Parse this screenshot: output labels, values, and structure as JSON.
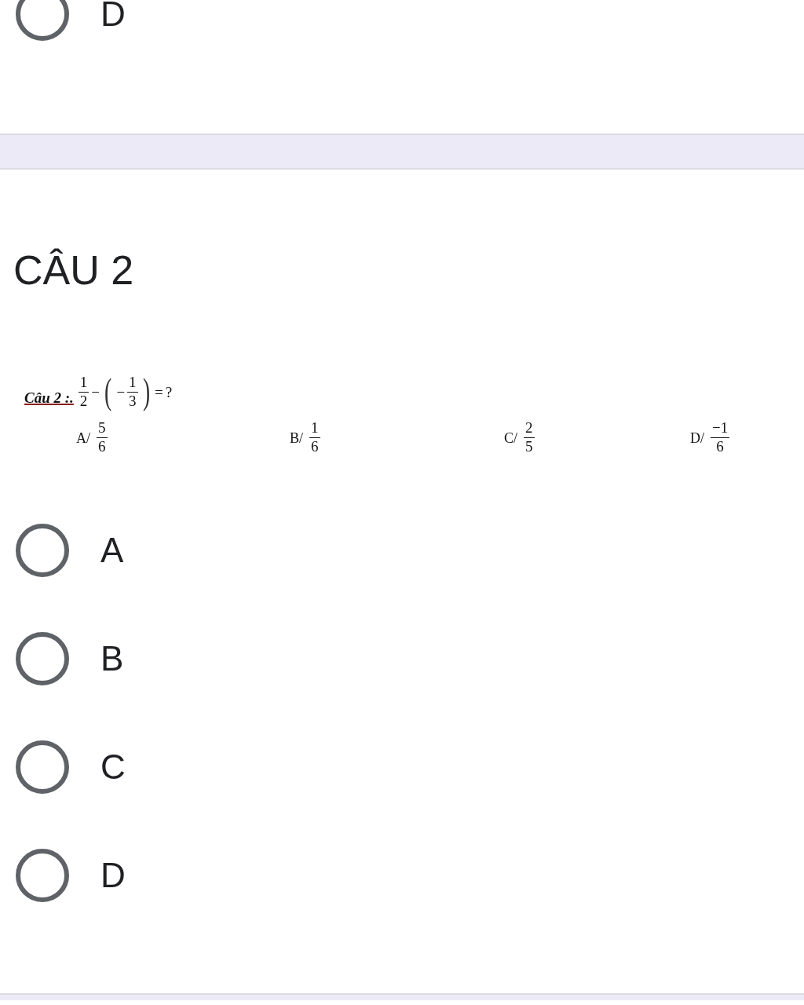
{
  "previous_question": {
    "options": [
      {
        "label": "D",
        "selected": false
      }
    ]
  },
  "question": {
    "title": "CÂU 2",
    "image": {
      "label": "Câu 2 :.",
      "formula": [
        {
          "kind": "fraction",
          "numerator": "1",
          "denominator": "2"
        },
        {
          "kind": "operator",
          "text": "−"
        },
        {
          "kind": "bracket",
          "text": "("
        },
        {
          "kind": "operator",
          "text": "−"
        },
        {
          "kind": "fraction",
          "numerator": "1",
          "denominator": "3"
        },
        {
          "kind": "bracket",
          "text": ")"
        },
        {
          "kind": "operator",
          "text": "="
        },
        {
          "kind": "operator",
          "text": "?"
        }
      ],
      "choices": [
        {
          "label": "A/",
          "numerator": "5",
          "denominator": "6"
        },
        {
          "label": "B/",
          "numerator": "1",
          "denominator": "6"
        },
        {
          "label": "C/",
          "numerator": "2",
          "denominator": "5"
        },
        {
          "label": "D/",
          "numerator": "−1",
          "denominator": "6"
        }
      ]
    },
    "options": [
      {
        "label": "A",
        "selected": false
      },
      {
        "label": "B",
        "selected": false
      },
      {
        "label": "C",
        "selected": false
      },
      {
        "label": "D",
        "selected": false
      }
    ]
  }
}
